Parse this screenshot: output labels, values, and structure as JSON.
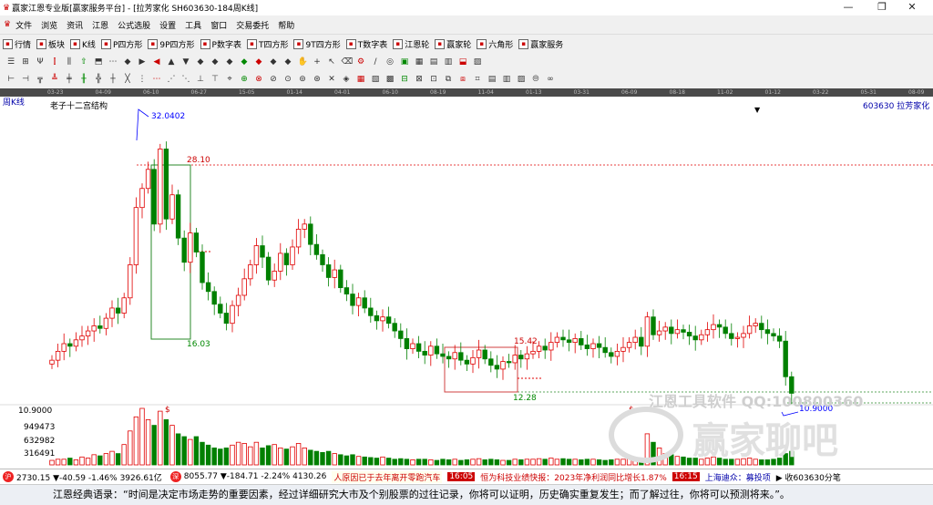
{
  "window": {
    "title": "赢家江恩专业版[赢家服务平台] - [拉芳家化  SH603630-184周K线]",
    "min": "—",
    "max": "❐",
    "close": "✕"
  },
  "menu": {
    "items": [
      "文件",
      "浏览",
      "资讯",
      "江恩",
      "公式选股",
      "设置",
      "工具",
      "窗口",
      "交易委托",
      "帮助"
    ]
  },
  "toolbar": {
    "items": [
      {
        "icon": "list-icon",
        "label": "行情"
      },
      {
        "icon": "grid-icon",
        "label": "板块"
      },
      {
        "icon": "kline-icon",
        "label": "K线"
      },
      {
        "icon": "p-square-icon",
        "label": "P四方形"
      },
      {
        "icon": "9p-square-icon",
        "label": "9P四方形"
      },
      {
        "icon": "p-table-icon",
        "label": "P数字表"
      },
      {
        "icon": "t-square-icon",
        "label": "T四方形"
      },
      {
        "icon": "9t-square-icon",
        "label": "9T四方形"
      },
      {
        "icon": "t-table-icon",
        "label": "T数字表"
      },
      {
        "icon": "gann-wheel-icon",
        "label": "江恩轮"
      },
      {
        "icon": "winner-wheel-icon",
        "label": "赢家轮"
      },
      {
        "icon": "hexagon-icon",
        "label": "六角形"
      },
      {
        "icon": "service-icon",
        "label": "赢家服务"
      }
    ]
  },
  "timeline": [
    "03-23",
    "04-09",
    "06-10",
    "06-27",
    "15-05",
    "01-14",
    "04-01",
    "06-10",
    "08-19",
    "11-04",
    "01-13",
    "03-31",
    "06-09",
    "08-18",
    "11-02",
    "01-12",
    "03-22",
    "05-31",
    "08-09"
  ],
  "chart": {
    "period_label": "周K线",
    "indicator_label": "老子十二宫结构",
    "stock": "603630 拉芳家化",
    "dropdown_marker": "▼",
    "high_label": "32.0402",
    "low_label": "10.9000",
    "gann_top": "28.10",
    "gann_bottom": "16.03",
    "box2_top": "15.42",
    "box2_bottom": "12.28",
    "vol_ticks": [
      "10.9000",
      "949473",
      "632982",
      "316491"
    ],
    "watermark1": "江恩工具软件  QQ:100800360",
    "watermark2": "赢家聊吧",
    "dollar_mark": "$",
    "colors": {
      "up": "#e00000",
      "down": "#008000",
      "dash": "#e00000",
      "box": "#d04040",
      "gbox": "#2a8a2a",
      "label": "#0000ff"
    }
  },
  "chart_data": {
    "type": "candlestick",
    "closes": [
      13.5,
      14.2,
      14.8,
      14.6,
      15.1,
      15.4,
      15.8,
      16.2,
      16.0,
      16.8,
      17.6,
      17.2,
      18.4,
      21.0,
      25.5,
      27.0,
      28.5,
      24.2,
      30.1,
      24.6,
      26.5,
      23.1,
      21.2,
      23.5,
      22.0,
      19.6,
      18.9,
      17.9,
      17.2,
      16.4,
      17.8,
      18.6,
      19.9,
      21.0,
      22.5,
      21.6,
      19.8,
      20.5,
      21.9,
      21.0,
      22.4,
      23.8,
      24.2,
      22.6,
      21.8,
      21.0,
      20.0,
      20.6,
      19.2,
      18.7,
      17.8,
      18.4,
      17.6,
      17.0,
      16.6,
      16.9,
      16.4,
      15.8,
      15.2,
      14.4,
      14.8,
      14.2,
      13.9,
      14.6,
      14.0,
      13.8,
      13.6,
      14.1,
      13.5,
      13.2,
      13.7,
      14.3,
      13.6,
      13.1,
      12.8,
      13.4,
      13.3,
      13.9,
      13.6,
      14.0,
      14.2,
      14.6,
      14.3,
      14.9,
      15.3,
      15.1,
      14.9,
      15.2,
      14.7,
      14.4,
      14.8,
      14.5,
      14.1,
      13.8,
      14.2,
      14.5,
      14.9,
      15.3,
      14.6,
      16.9,
      15.5,
      15.8,
      16.1,
      15.6,
      15.9,
      15.7,
      15.4,
      15.1,
      15.5,
      15.9,
      16.3,
      16.1,
      15.6,
      15.2,
      15.3,
      15.6,
      16.2,
      16.4,
      15.9,
      15.6,
      15.4,
      15.0,
      12.2,
      10.9
    ],
    "volumes": [
      0.08,
      0.1,
      0.1,
      0.12,
      0.09,
      0.14,
      0.12,
      0.18,
      0.16,
      0.2,
      0.24,
      0.2,
      0.36,
      0.6,
      0.85,
      1.0,
      0.8,
      0.7,
      0.95,
      0.8,
      0.7,
      0.55,
      0.5,
      0.45,
      0.5,
      0.4,
      0.35,
      0.3,
      0.28,
      0.3,
      0.35,
      0.4,
      0.38,
      0.32,
      0.4,
      0.3,
      0.34,
      0.36,
      0.3,
      0.28,
      0.32,
      0.38,
      0.3,
      0.26,
      0.24,
      0.22,
      0.24,
      0.2,
      0.18,
      0.16,
      0.18,
      0.15,
      0.14,
      0.13,
      0.12,
      0.14,
      0.12,
      0.1,
      0.11,
      0.1,
      0.09,
      0.1,
      0.1,
      0.09,
      0.08,
      0.1,
      0.09,
      0.1,
      0.08,
      0.09,
      0.1,
      0.11,
      0.09,
      0.1,
      0.09,
      0.08,
      0.08,
      0.1,
      0.09,
      0.1,
      0.1,
      0.11,
      0.1,
      0.12,
      0.1,
      0.11,
      0.1,
      0.1,
      0.09,
      0.1,
      0.1,
      0.09,
      0.08,
      0.09,
      0.1,
      0.1,
      0.12,
      0.11,
      0.12,
      0.55,
      0.4,
      0.3,
      0.2,
      0.18,
      0.15,
      0.14,
      0.12,
      0.12,
      0.1,
      0.12,
      0.14,
      0.12,
      0.1,
      0.1,
      0.1,
      0.11,
      0.12,
      0.1,
      0.09,
      0.09,
      0.1,
      0.12,
      0.2,
      0.24
    ]
  },
  "status": {
    "sh_index": "2730.15 ▼-40.59 -1.46% 3926.61亿",
    "sz_index": "8055.77 ▼-184.71 -2.24% 4130.26",
    "news1": "人原因已于去年离开零跑汽车",
    "time1": "16:05",
    "news2": "恒为科技业绩快报：2023年净利润同比增长1.87%",
    "time2": "16:15",
    "news3": "上海迪众：募投项",
    "watch": "▶ 收603630分笔"
  },
  "quote": "江恩经典语录：“时间是决定市场走势的重要因素，经过详细研究大市及个别股票的过往记录，你将可以证明，历史确实重复发生；而了解过往，你将可以预测将来。”。"
}
